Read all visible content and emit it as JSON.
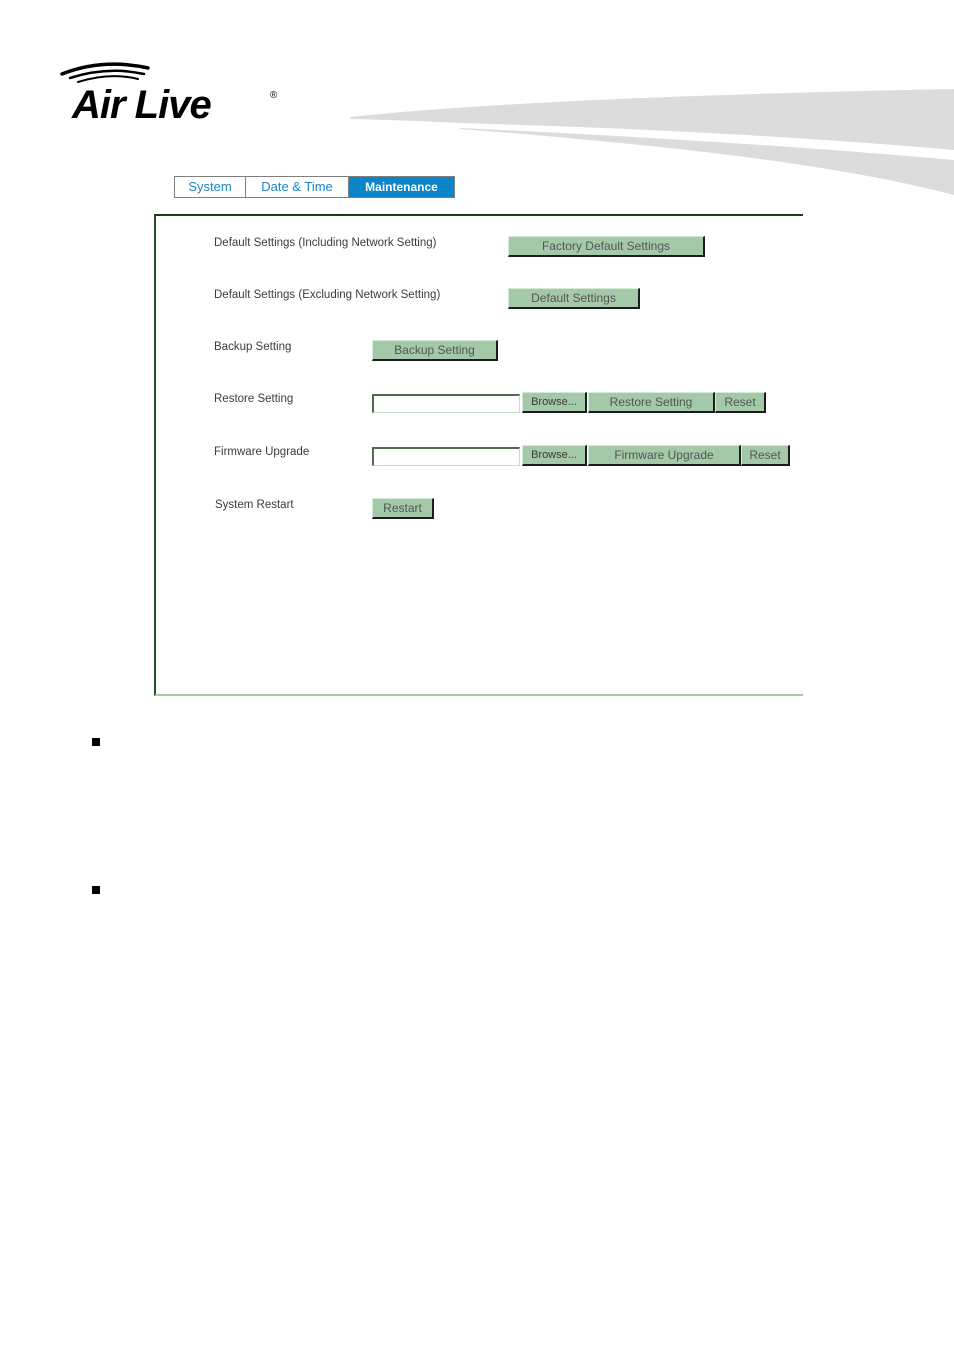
{
  "brand": {
    "logo_text": "Air Live",
    "registered_mark": "®"
  },
  "tabs": [
    {
      "label": "System",
      "active": false
    },
    {
      "label": "Date & Time",
      "active": false
    },
    {
      "label": "Maintenance",
      "active": true
    }
  ],
  "maintenance": {
    "factory_default": {
      "label": "Default Settings (Including Network Setting)",
      "button": "Factory Default Settings"
    },
    "default_settings": {
      "label": "Default Settings (Excluding Network Setting)",
      "button": "Default Settings"
    },
    "backup": {
      "label": "Backup Setting",
      "button": "Backup Setting"
    },
    "restore": {
      "label": "Restore Setting",
      "file_value": "",
      "browse_button": "Browse...",
      "action_button": "Restore Setting",
      "reset_button": "Reset"
    },
    "firmware": {
      "label": "Firmware Upgrade",
      "file_value": "",
      "browse_button": "Browse...",
      "action_button": "Firmware Upgrade",
      "reset_button": "Reset"
    },
    "restart": {
      "label": "System Restart",
      "button": "Restart"
    }
  },
  "colors": {
    "tab_active_bg": "#0b84c8",
    "tab_text": "#1a86c8",
    "button_bg": "#a3c9a8",
    "swoosh": "#dcdcdc"
  },
  "bullets": [
    {
      "icon": "square-bullet-icon"
    },
    {
      "icon": "square-bullet-icon"
    }
  ]
}
